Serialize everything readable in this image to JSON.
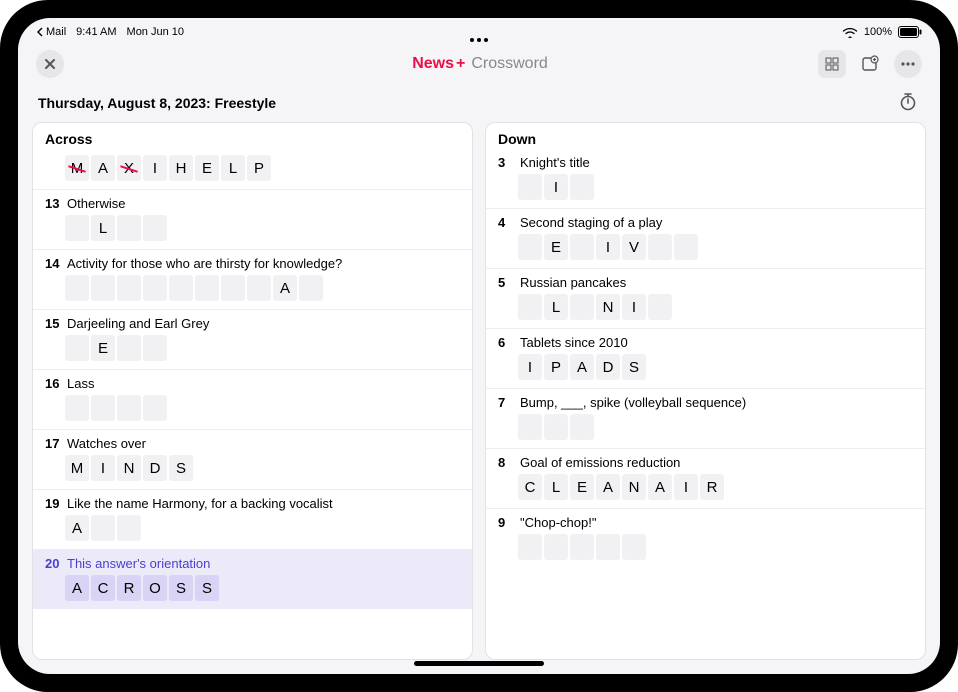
{
  "status_bar": {
    "breadcrumb_app": "Mail",
    "time": "9:41 AM",
    "date": "Mon Jun 10",
    "battery_pct": "100%"
  },
  "toolbar": {
    "brand_news": "News",
    "brand_plus": "+",
    "brand_sub": "Crossword"
  },
  "subtitle": "Thursday, August 8, 2023: Freestyle",
  "across": {
    "header": "Across",
    "clues": [
      {
        "num": "",
        "text": "",
        "cells": [
          "M",
          "A",
          "X",
          "I",
          "H",
          "E",
          "L",
          "P"
        ],
        "wrong": [
          0,
          2
        ],
        "hide_line": true
      },
      {
        "num": "13",
        "text": "Otherwise",
        "cells": [
          "",
          "L",
          "",
          ""
        ]
      },
      {
        "num": "14",
        "text": "Activity for those who are thirsty for knowledge?",
        "cells": [
          "",
          "",
          "",
          "",
          "",
          "",
          "",
          "",
          "A",
          ""
        ]
      },
      {
        "num": "15",
        "text": "Darjeeling and Earl Grey",
        "cells": [
          "",
          "E",
          "",
          ""
        ]
      },
      {
        "num": "16",
        "text": "Lass",
        "cells": [
          "",
          "",
          "",
          ""
        ]
      },
      {
        "num": "17",
        "text": "Watches over",
        "cells": [
          "M",
          "I",
          "N",
          "D",
          "S"
        ]
      },
      {
        "num": "19",
        "text": "Like the name Harmony, for a backing vocalist",
        "cells": [
          "A",
          "",
          ""
        ]
      },
      {
        "num": "20",
        "text": "This answer's orientation",
        "cells": [
          "A",
          "C",
          "R",
          "O",
          "S",
          "S"
        ],
        "selected": true
      }
    ]
  },
  "down": {
    "header": "Down",
    "clues": [
      {
        "num": "3",
        "text": "Knight's title",
        "cells": [
          "",
          "I",
          ""
        ]
      },
      {
        "num": "4",
        "text": "Second staging of a play",
        "cells": [
          "",
          "E",
          "",
          "I",
          "V",
          "",
          ""
        ]
      },
      {
        "num": "5",
        "text": "Russian pancakes",
        "cells": [
          "",
          "L",
          "",
          "N",
          "I",
          ""
        ]
      },
      {
        "num": "6",
        "text": "Tablets since 2010",
        "cells": [
          "I",
          "P",
          "A",
          "D",
          "S"
        ]
      },
      {
        "num": "7",
        "text": "Bump, ___, spike (volleyball sequence)",
        "cells": [
          "",
          "",
          ""
        ]
      },
      {
        "num": "8",
        "text": "Goal of emissions reduction",
        "cells": [
          "C",
          "L",
          "E",
          "A",
          "N",
          "A",
          "I",
          "R"
        ]
      },
      {
        "num": "9",
        "text": "\"Chop-chop!\"",
        "cells": [
          "",
          "",
          "",
          "",
          ""
        ]
      }
    ]
  }
}
